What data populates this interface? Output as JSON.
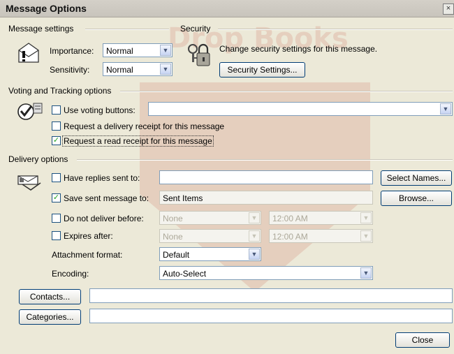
{
  "window": {
    "title": "Message Options",
    "close_glyph": "×"
  },
  "message_settings": {
    "heading": "Message settings",
    "importance": {
      "label": "Importance:",
      "value": "Normal"
    },
    "sensitivity": {
      "label": "Sensitivity:",
      "value": "Normal"
    }
  },
  "security": {
    "heading": "Security",
    "description": "Change security settings for this message.",
    "button": "Security Settings..."
  },
  "voting": {
    "heading": "Voting and Tracking options",
    "use_voting_label": "Use voting buttons:",
    "use_voting_value": "",
    "delivery_receipt_label": "Request a delivery receipt for this message",
    "read_receipt_label": "Request a read receipt for this message"
  },
  "delivery": {
    "heading": "Delivery options",
    "replies_label": "Have replies sent to:",
    "replies_value": "",
    "select_names_button": "Select Names...",
    "save_sent_label": "Save sent message to:",
    "save_sent_value": "Sent Items",
    "browse_button": "Browse...",
    "do_not_deliver_label": "Do not deliver before:",
    "do_not_deliver_date": "None",
    "do_not_deliver_time": "12:00 AM",
    "expires_label": "Expires after:",
    "expires_date": "None",
    "expires_time": "12:00 AM",
    "attachment_label": "Attachment format:",
    "attachment_value": "Default",
    "encoding_label": "Encoding:",
    "encoding_value": "Auto-Select"
  },
  "footer": {
    "contacts_button": "Contacts...",
    "contacts_value": "",
    "categories_button": "Categories...",
    "categories_value": "",
    "close_button": "Close"
  },
  "checkboxes": {
    "use_voting": false,
    "delivery_receipt": false,
    "read_receipt": true,
    "have_replies": false,
    "save_sent": true,
    "do_not_deliver": false,
    "expires": false
  },
  "icons": {
    "message_settings": "envelope-importance-icon",
    "security": "lock-key-icon",
    "voting": "checkmark-voting-icon",
    "delivery": "delivery-envelope-icon"
  },
  "watermark_text": "Drop Books"
}
